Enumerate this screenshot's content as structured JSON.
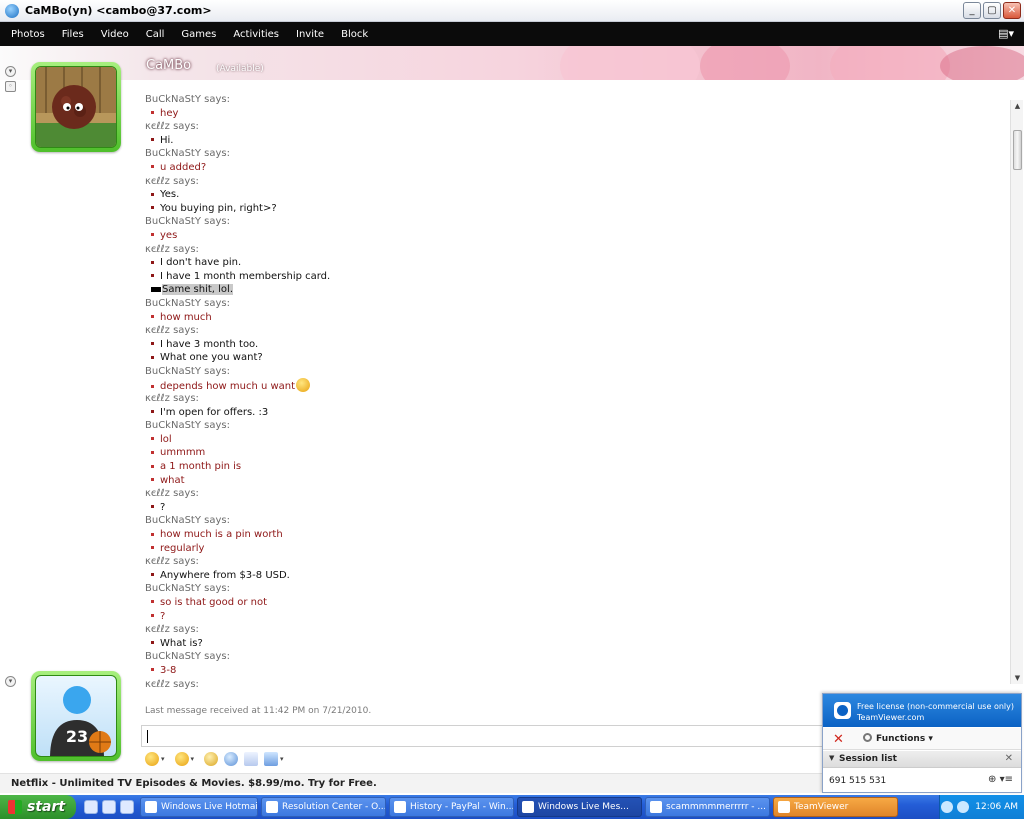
{
  "window": {
    "title": "CaMBo(yn) <cambo@37.com>",
    "controls": [
      "_",
      "▢",
      "✕"
    ]
  },
  "menu": {
    "items": [
      "Photos",
      "Files",
      "Video",
      "Call",
      "Games",
      "Activities",
      "Invite",
      "Block"
    ]
  },
  "contact": {
    "name": "CaMBo",
    "status": "(Available)"
  },
  "conversation": [
    {
      "type": "sender",
      "text": "BuCkNaStY says:"
    },
    {
      "type": "msg",
      "style": "red",
      "text": "hey"
    },
    {
      "type": "sender",
      "text": "κєℓℓz says:"
    },
    {
      "type": "msg",
      "style": "black",
      "text": "Hi."
    },
    {
      "type": "sender",
      "text": "BuCkNaStY says:"
    },
    {
      "type": "msg",
      "style": "red",
      "text": "u added?"
    },
    {
      "type": "sender",
      "text": "κєℓℓz says:"
    },
    {
      "type": "msg",
      "style": "black",
      "text": "Yes."
    },
    {
      "type": "msg",
      "style": "black",
      "text": "You buying pin, right>?"
    },
    {
      "type": "sender",
      "text": "BuCkNaStY says:"
    },
    {
      "type": "msg",
      "style": "red",
      "text": "yes"
    },
    {
      "type": "sender",
      "text": "κєℓℓz says:"
    },
    {
      "type": "msg",
      "style": "black",
      "text": "I don't have pin."
    },
    {
      "type": "msg",
      "style": "black",
      "text": "I have 1 month membership card."
    },
    {
      "type": "msg",
      "style": "black-highlight",
      "text": "Same shit, lol."
    },
    {
      "type": "sender",
      "text": "BuCkNaStY says:"
    },
    {
      "type": "msg",
      "style": "red",
      "text": "how much"
    },
    {
      "type": "sender",
      "text": "κєℓℓz says:"
    },
    {
      "type": "msg",
      "style": "black",
      "text": "I have 3 month too."
    },
    {
      "type": "msg",
      "style": "black",
      "text": "What one you want?"
    },
    {
      "type": "sender",
      "text": "BuCkNaStY says:"
    },
    {
      "type": "msg",
      "style": "red-emoticon",
      "text": "depends how much u want"
    },
    {
      "type": "sender",
      "text": "κєℓℓz says:"
    },
    {
      "type": "msg",
      "style": "black",
      "text": "I'm open for offers. :3"
    },
    {
      "type": "sender",
      "text": "BuCkNaStY says:"
    },
    {
      "type": "msg",
      "style": "red",
      "text": "lol"
    },
    {
      "type": "msg",
      "style": "red",
      "text": "ummmm"
    },
    {
      "type": "msg",
      "style": "red",
      "text": "a 1 month pin is"
    },
    {
      "type": "msg",
      "style": "red",
      "text": "what"
    },
    {
      "type": "sender",
      "text": "κєℓℓz says:"
    },
    {
      "type": "msg",
      "style": "black",
      "text": "?"
    },
    {
      "type": "sender",
      "text": "BuCkNaStY says:"
    },
    {
      "type": "msg",
      "style": "red",
      "text": "how much is a pin worth"
    },
    {
      "type": "msg",
      "style": "red",
      "text": "regularly"
    },
    {
      "type": "sender",
      "text": "κєℓℓz says:"
    },
    {
      "type": "msg",
      "style": "black",
      "text": "Anywhere from $3-8 USD."
    },
    {
      "type": "sender",
      "text": "BuCkNaStY says:"
    },
    {
      "type": "msg",
      "style": "red",
      "text": "so is that good or not"
    },
    {
      "type": "msg",
      "style": "red",
      "text": "?"
    },
    {
      "type": "sender",
      "text": "κєℓℓz says:"
    },
    {
      "type": "msg",
      "style": "black",
      "text": "What is?"
    },
    {
      "type": "sender",
      "text": "BuCkNaStY says:"
    },
    {
      "type": "msg",
      "style": "red",
      "text": "3-8"
    },
    {
      "type": "sender",
      "text": "κєℓℓz says:"
    }
  ],
  "last_message": "Last message received at 11:42 PM on 7/21/2010.",
  "input": {
    "value": ""
  },
  "toolbar": {
    "icons": [
      "emoticon-icon",
      "wink-icon",
      "nudge-icon",
      "voice-clip-icon",
      "font-icon",
      "background-icon"
    ]
  },
  "ad": {
    "text": "Netflix - Unlimited TV Episodes & Movies. $8.99/mo. Try for Free."
  },
  "teamviewer": {
    "license_line1": "Free license (non-commercial use only)",
    "license_line2": "TeamViewer.com",
    "functions_label": "Functions",
    "session_list_label": "Session list",
    "session_id": "691 515 531"
  },
  "taskbar": {
    "start_label": "start",
    "tasks": [
      {
        "label": "Windows Live Hotmail...",
        "state": "normal"
      },
      {
        "label": "Resolution Center - O...",
        "state": "normal"
      },
      {
        "label": "History - PayPal - Win...",
        "state": "normal"
      },
      {
        "label": "Windows Live Mes...",
        "state": "active"
      },
      {
        "label": "scammmmmerrrrr - ...",
        "state": "normal"
      },
      {
        "label": "TeamViewer",
        "state": "highlight"
      }
    ],
    "clock": "12:06 AM"
  }
}
